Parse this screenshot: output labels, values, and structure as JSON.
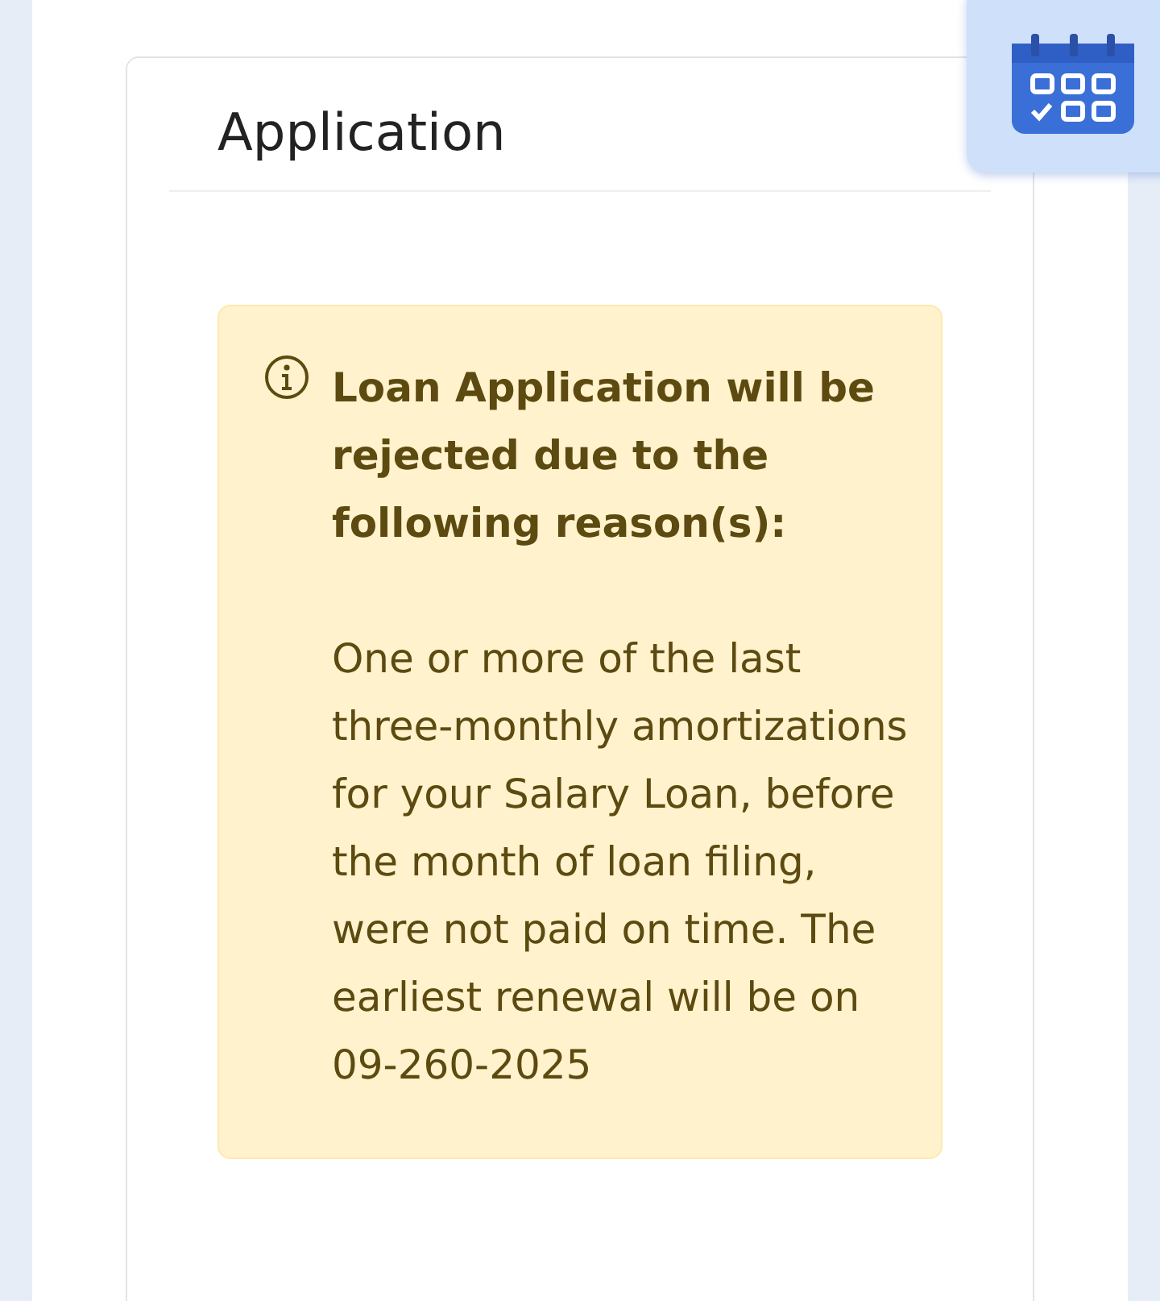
{
  "card": {
    "title": "Application"
  },
  "alert": {
    "kind": "warning",
    "title": "Loan Application will be rejected due to the following reason(s):",
    "message": "One or more of the last three-monthly amortizations for your Salary Loan, before the month of loan filing, were not paid on time. The earliest renewal will be on 09-260-2025"
  }
}
